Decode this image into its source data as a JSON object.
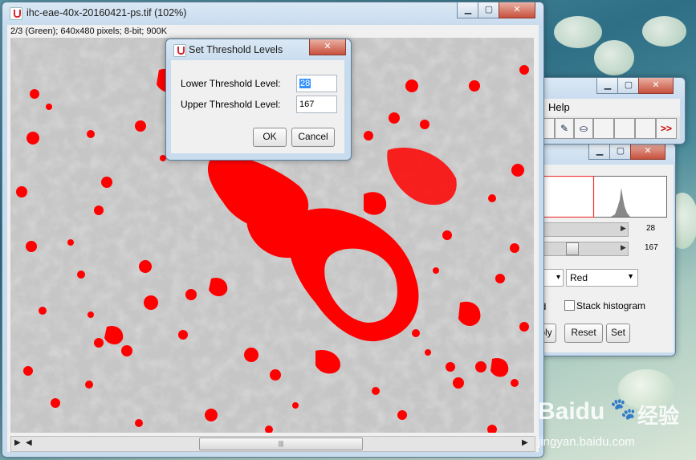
{
  "main_window": {
    "title": "ihc-eae-40x-20160421-ps.tif (102%)",
    "info": "2/3 (Green); 640x480 pixels; 8-bit; 900K",
    "minimize": "▁",
    "maximize": "▢",
    "close": "✕"
  },
  "dialog": {
    "title": "Set Threshold Levels",
    "lower_label": "Lower Threshold Level:",
    "lower_value": "28",
    "upper_label": "Upper Threshold Level:",
    "upper_value": "167",
    "ok": "OK",
    "cancel": "Cancel",
    "close": "✕"
  },
  "toolbar_window": {
    "menu_help": "Help",
    "more": ">>"
  },
  "threshold_window": {
    "lower_value": "28",
    "upper_value": "167",
    "lower_fraction": 0.11,
    "upper_fraction": 0.655,
    "color_mode": "Red",
    "partial_label": "nd",
    "stack_histogram": "Stack histogram",
    "apply_partial": "ply",
    "reset": "Reset",
    "set": "Set"
  },
  "watermark": {
    "brand": "Baidu",
    "brand_cn": "经验",
    "url": "jingyan.baidu.com"
  },
  "colors": {
    "threshold_overlay": "#ff0000",
    "image_gray": "#c8c8c8"
  }
}
